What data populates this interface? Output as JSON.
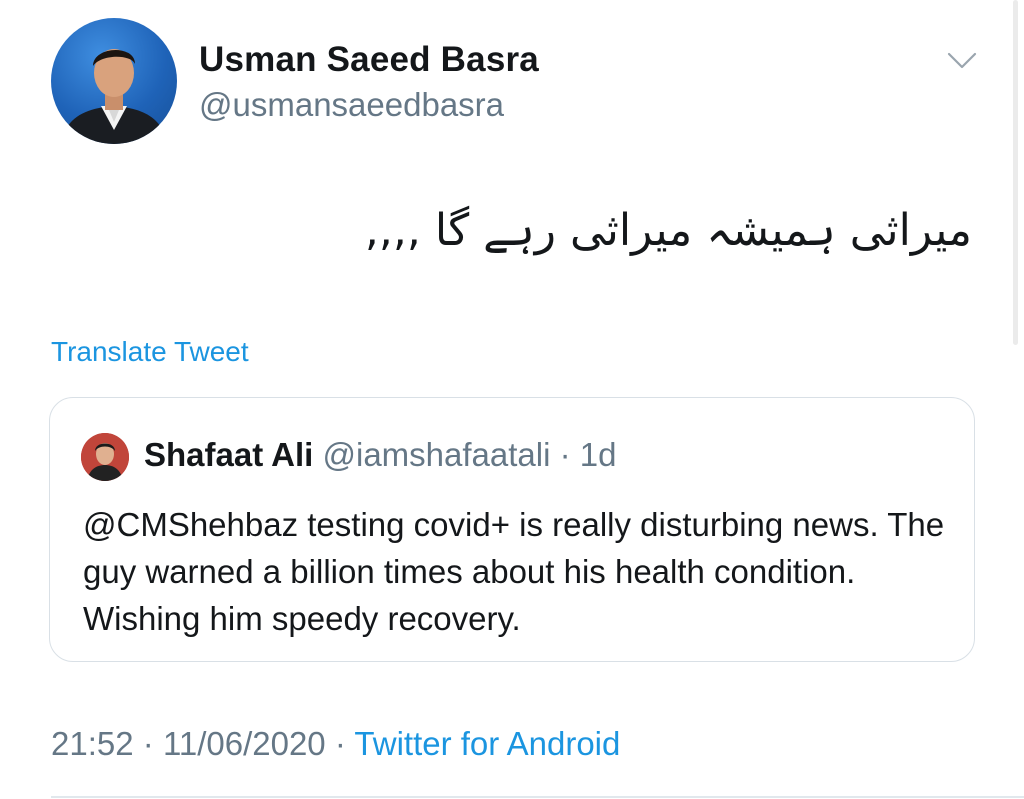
{
  "tweet": {
    "author": {
      "name": "Usman Saeed Basra",
      "handle": "@usmansaeedbasra"
    },
    "text": "میراثی ہمیشہ میراثی رہے گا ,,,,",
    "translate_label": "Translate Tweet",
    "quoted": {
      "name": "Shafaat Ali",
      "handle": "@iamshafaatali",
      "separator": "·",
      "time": "1d",
      "text": "@CMShehbaz testing covid+ is really disturbing news. The guy warned a billion times about his health condition. Wishing him speedy recovery."
    },
    "footer": {
      "time": "21:52",
      "separator1": "·",
      "date": "11/06/2020",
      "separator2": "·",
      "source": "Twitter for Android"
    }
  },
  "icons": {
    "menu": "chevron-down-icon"
  },
  "colors": {
    "text": "#14171a",
    "secondary": "#657786",
    "link": "#1b95e0",
    "border": "#d9e0e6"
  }
}
